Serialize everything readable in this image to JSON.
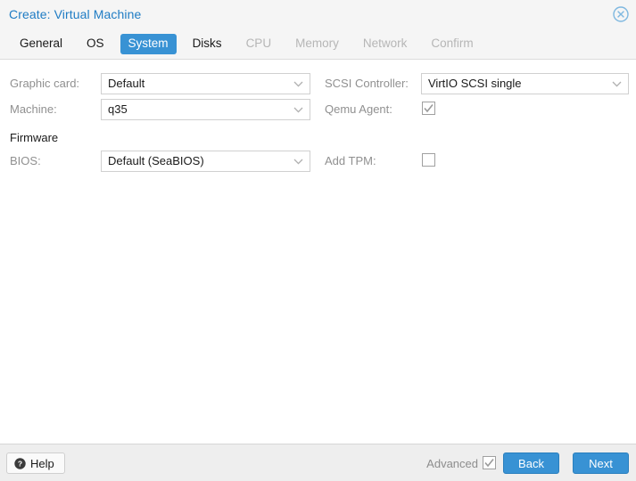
{
  "window": {
    "title": "Create: Virtual Machine",
    "close_icon": "close-circle-icon",
    "accent_color": "#3892d4",
    "title_color": "#1f7cc4"
  },
  "tabs": [
    {
      "label": "General",
      "state": "enabled"
    },
    {
      "label": "OS",
      "state": "enabled"
    },
    {
      "label": "System",
      "state": "active"
    },
    {
      "label": "Disks",
      "state": "enabled"
    },
    {
      "label": "CPU",
      "state": "disabled"
    },
    {
      "label": "Memory",
      "state": "disabled"
    },
    {
      "label": "Network",
      "state": "disabled"
    },
    {
      "label": "Confirm",
      "state": "disabled"
    }
  ],
  "form": {
    "left": {
      "graphic_card": {
        "label": "Graphic card:",
        "value": "Default",
        "type": "select"
      },
      "machine": {
        "label": "Machine:",
        "value": "q35",
        "type": "select"
      },
      "firmware_section": {
        "label": "Firmware"
      },
      "bios": {
        "label": "BIOS:",
        "value": "Default (SeaBIOS)",
        "type": "select"
      }
    },
    "right": {
      "scsi_controller": {
        "label": "SCSI Controller:",
        "value": "VirtIO SCSI single",
        "type": "select"
      },
      "qemu_agent": {
        "label": "Qemu Agent:",
        "checked": true,
        "type": "checkbox"
      },
      "add_tpm": {
        "label": "Add TPM:",
        "checked": false,
        "type": "checkbox"
      }
    }
  },
  "footer": {
    "help_label": "Help",
    "help_icon": "question-circle-icon",
    "advanced_label": "Advanced",
    "advanced_checked": true,
    "back_label": "Back",
    "next_label": "Next"
  }
}
